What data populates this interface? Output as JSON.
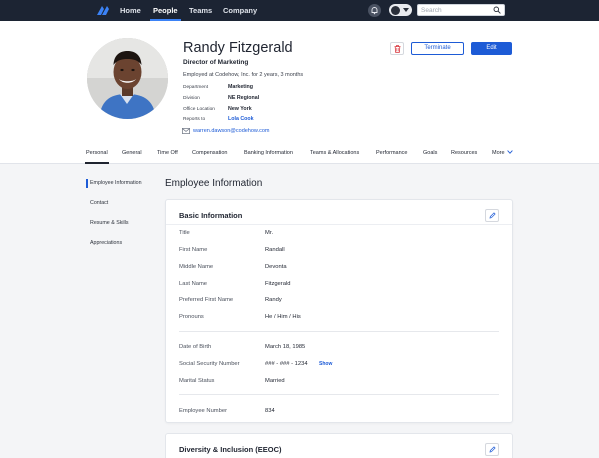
{
  "nav": {
    "links": [
      "Home",
      "People",
      "Teams",
      "Company"
    ],
    "active": "People",
    "search_placeholder": "Search"
  },
  "profile": {
    "name": "Randy Fitzgerald",
    "title": "Director of Marketing",
    "employed": "Employed at Codehow, Inc. for 2 years, 3 months",
    "details": [
      {
        "label": "Department",
        "value": "Marketing"
      },
      {
        "label": "Division",
        "value": "NE Regional"
      },
      {
        "label": "Office Location",
        "value": "New York"
      },
      {
        "label": "Reports to",
        "value": "Lola Cook"
      }
    ],
    "email": "warren.dawson@codehow.com"
  },
  "actions": {
    "terminate": "Terminate",
    "edit": "Edit"
  },
  "tabs": [
    "Personal",
    "General",
    "Time Off",
    "Compensation",
    "Banking Information",
    "Teams & Allocations",
    "Performance",
    "Goals",
    "Resources",
    "More"
  ],
  "active_tab": "Personal",
  "left_nav": [
    "Employee Information",
    "Contact",
    "Resume & Skills",
    "Appreciations"
  ],
  "section_title": "Employee Information",
  "basic_info": {
    "title": "Basic Information",
    "fields": [
      {
        "label": "Title",
        "value": "Mr."
      },
      {
        "label": "First Name",
        "value": "Randall"
      },
      {
        "label": "Middle Name",
        "value": "Devonta"
      },
      {
        "label": "Last Name",
        "value": "Fitzgerald"
      },
      {
        "label": "Preferred First Name",
        "value": "Randy"
      },
      {
        "label": "Pronouns",
        "value": "He / Him / His"
      },
      {
        "label": "Date of Birth",
        "value": "March 18, 1985"
      },
      {
        "label": "Social Security Number",
        "value": "### - ### - 1234"
      },
      {
        "label": "Marital Status",
        "value": "Married"
      },
      {
        "label": "Employee Number",
        "value": "834"
      }
    ],
    "show_label": "Show"
  },
  "diversity": {
    "title": "Diversity & Inclusion (EEOC)"
  },
  "colors": {
    "nav_bg": "#1c2433",
    "accent": "#1d5bd6",
    "danger": "#d9363e"
  }
}
